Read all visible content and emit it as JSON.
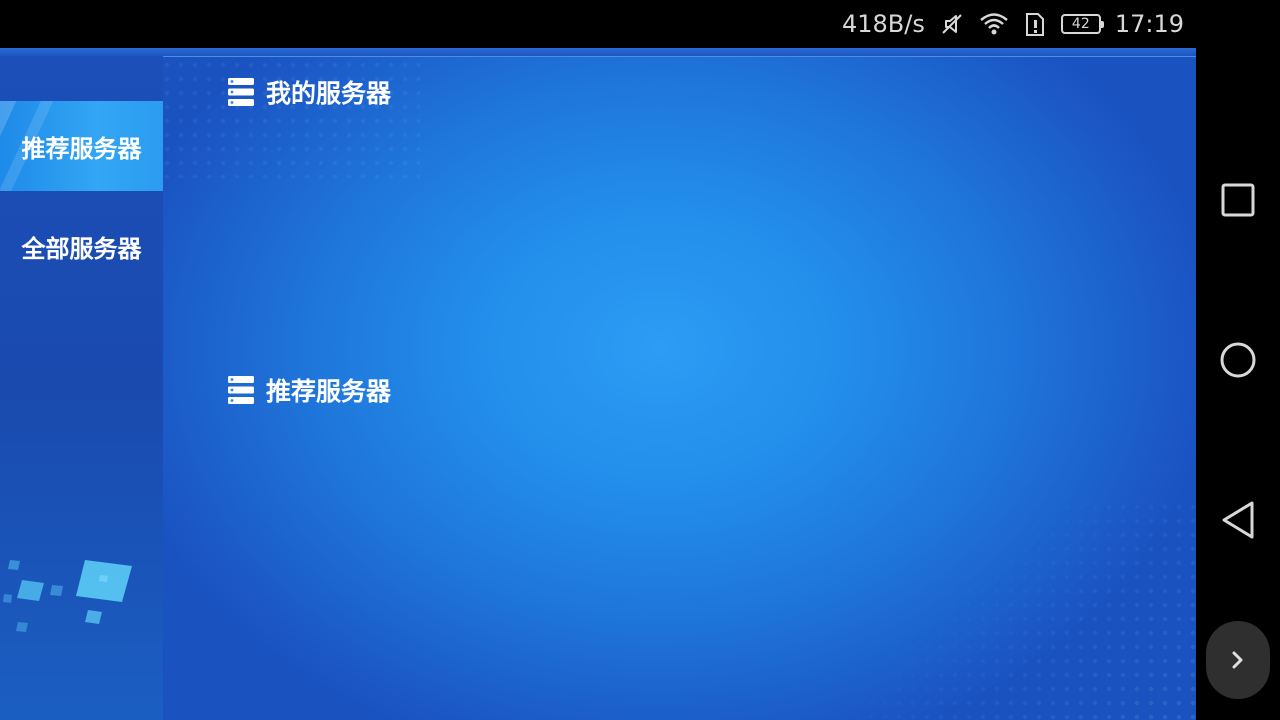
{
  "status_bar": {
    "net_speed": "418B/s",
    "battery_level": "42",
    "time": "17:19",
    "icons": [
      "mute-icon",
      "wifi-icon",
      "sim-alert-icon",
      "battery-icon"
    ]
  },
  "sidebar": {
    "tabs": [
      {
        "label": "推荐服务器",
        "active": true
      },
      {
        "label": "全部服务器",
        "active": false
      }
    ]
  },
  "sections": [
    {
      "title": "我的服务器",
      "icon": "server-icon"
    },
    {
      "title": "推荐服务器",
      "icon": "server-icon"
    }
  ],
  "nav": {
    "buttons": [
      "recents-icon",
      "home-icon",
      "back-icon"
    ],
    "floating": "chevron-right-icon"
  },
  "colors": {
    "background": "#2390ec",
    "sidebar": "#1c4fb9",
    "active_tab": "#2b9cf2",
    "text": "#ffffff"
  }
}
